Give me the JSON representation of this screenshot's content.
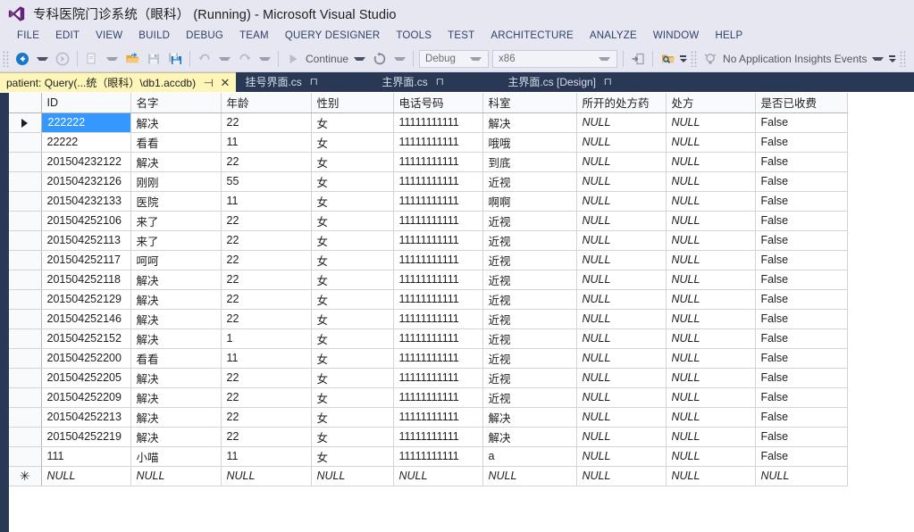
{
  "window": {
    "title": "专科医院门诊系统（眼科）  (Running) - Microsoft Visual Studio",
    "logo_icon": "visual-studio-logo-icon"
  },
  "menubar": {
    "items": [
      {
        "label": "FILE"
      },
      {
        "label": "EDIT"
      },
      {
        "label": "VIEW"
      },
      {
        "label": "BUILD"
      },
      {
        "label": "DEBUG"
      },
      {
        "label": "TEAM"
      },
      {
        "label": "QUERY DESIGNER"
      },
      {
        "label": "TOOLS"
      },
      {
        "label": "TEST"
      },
      {
        "label": "ARCHITECTURE"
      },
      {
        "label": "ANALYZE"
      },
      {
        "label": "WINDOW"
      },
      {
        "label": "HELP"
      }
    ]
  },
  "toolbar": {
    "navigate_back_icon": "navigate-back-icon",
    "navigate_forward_icon": "navigate-forward-icon",
    "new_item_icon": "new-item-icon",
    "open_file_icon": "open-folder-icon",
    "save_icon": "save-icon",
    "save_all_icon": "save-all-icon",
    "undo_icon": "undo-icon",
    "redo_icon": "redo-icon",
    "continue_label": "Continue",
    "continue_icon": "play-continue-icon",
    "restart_icon": "restart-icon",
    "config_value": "Debug",
    "platform_value": "x86",
    "attach_icon": "attach-to-process-icon",
    "find_icon": "find-in-files-icon",
    "insights_icon": "application-insights-icon",
    "insights_label": "No Application Insights Events",
    "break_all_icon": "break-all-icon",
    "stop_icon": "stop-debugging-icon",
    "restart_debug_icon": "restart-debugging-icon",
    "show_next_statement_icon": "show-next-statement-icon",
    "step_into_icon": "step-into-icon",
    "step_over_icon": "step-over-icon"
  },
  "tabs": [
    {
      "label": "patient: Query(...统（眼科）\\db1.accdb)",
      "active": true,
      "pin": "⊣",
      "close": "✕"
    },
    {
      "label": "挂号界面.cs",
      "active": false,
      "pin": "⊓"
    },
    {
      "label": "主界面.cs",
      "active": false,
      "pin": "⊓"
    },
    {
      "label": "主界面.cs [Design]",
      "active": false,
      "pin": "⊓"
    }
  ],
  "grid": {
    "row_marker_current": "▶",
    "row_marker_new": "✳",
    "columns": [
      "ID",
      "名字",
      "年龄",
      "性别",
      "电话号码",
      "科室",
      "所开的处方药",
      "处方",
      "是否已收费"
    ],
    "selected_cell": {
      "row": 0,
      "col": 0,
      "value": "222222"
    },
    "rows": [
      [
        "222222",
        "解决",
        "22",
        "女",
        "11111111111",
        "解决",
        "NULL",
        "NULL",
        "False"
      ],
      [
        "22222",
        "看看",
        "11",
        "女",
        "11111111111",
        "哦哦",
        "NULL",
        "NULL",
        "False"
      ],
      [
        "201504232122",
        "解决",
        "22",
        "女",
        "11111111111",
        "到底",
        "NULL",
        "NULL",
        "False"
      ],
      [
        "201504232126",
        "刚刚",
        "55",
        "女",
        "11111111111",
        "近视",
        "NULL",
        "NULL",
        "False"
      ],
      [
        "201504232133",
        "医院",
        "11",
        "女",
        "11111111111",
        "啊啊",
        "NULL",
        "NULL",
        "False"
      ],
      [
        "201504252106",
        "来了",
        "22",
        "女",
        "11111111111",
        "近视",
        "NULL",
        "NULL",
        "False"
      ],
      [
        "201504252113",
        "来了",
        "22",
        "女",
        "11111111111",
        "近视",
        "NULL",
        "NULL",
        "False"
      ],
      [
        "201504252117",
        "呵呵",
        "22",
        "女",
        "11111111111",
        "近视",
        "NULL",
        "NULL",
        "False"
      ],
      [
        "201504252118",
        "解决",
        "22",
        "女",
        "11111111111",
        "近视",
        "NULL",
        "NULL",
        "False"
      ],
      [
        "201504252129",
        "解决",
        "22",
        "女",
        "11111111111",
        "近视",
        "NULL",
        "NULL",
        "False"
      ],
      [
        "201504252146",
        "解决",
        "22",
        "女",
        "11111111111",
        "近视",
        "NULL",
        "NULL",
        "False"
      ],
      [
        "201504252152",
        "解决",
        "1",
        "女",
        "11111111111",
        "近视",
        "NULL",
        "NULL",
        "False"
      ],
      [
        "201504252200",
        "看看",
        "11",
        "女",
        "11111111111",
        "近视",
        "NULL",
        "NULL",
        "False"
      ],
      [
        "201504252205",
        "解决",
        "22",
        "女",
        "11111111111",
        "近视",
        "NULL",
        "NULL",
        "False"
      ],
      [
        "201504252209",
        "解决",
        "22",
        "女",
        "11111111111",
        "近视",
        "NULL",
        "NULL",
        "False"
      ],
      [
        "201504252213",
        "解决",
        "22",
        "女",
        "11111111111",
        "解决",
        "NULL",
        "NULL",
        "False"
      ],
      [
        "201504252219",
        "解决",
        "22",
        "女",
        "11111111111",
        "解决",
        "NULL",
        "NULL",
        "False"
      ],
      [
        "111",
        "小喵",
        "11",
        "女",
        "11111111111",
        "a",
        "NULL",
        "NULL",
        "False"
      ],
      [
        "NULL",
        "NULL",
        "NULL",
        "NULL",
        "NULL",
        "NULL",
        "NULL",
        "NULL",
        "NULL"
      ]
    ]
  },
  "colors": {
    "chrome": "#e6e7f0",
    "tabstrip": "#293955",
    "active_tab": "#fdf6b8",
    "selection": "#3399ff"
  }
}
